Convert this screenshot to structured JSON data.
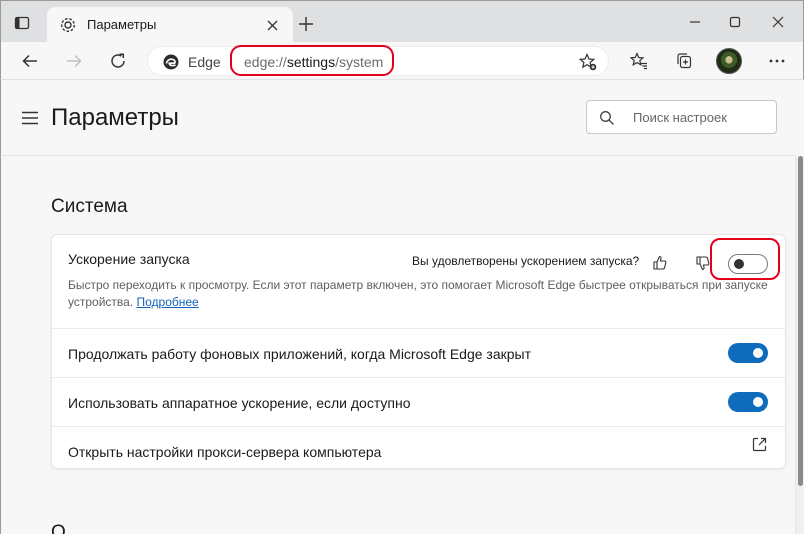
{
  "browser": {
    "tab_title": "Параметры",
    "edge_label": "Edge",
    "url_prefix": "edge://",
    "url_host": "settings",
    "url_path": "/system"
  },
  "page": {
    "title": "Параметры",
    "search_placeholder": "Поиск настроек"
  },
  "section": {
    "title": "Система",
    "next_title": "О"
  },
  "settings": {
    "startup_boost": {
      "label": "Ускорение запуска",
      "feedback_question": "Вы удовлетворены ускорением запуска?",
      "description": "Быстро переходить к просмотру. Если этот параметр включен, это помогает Microsoft Edge быстрее открываться при запуске устройства. ",
      "learn_more": "Подробнее",
      "enabled": false
    },
    "background_apps": {
      "label": "Продолжать работу фоновых приложений, когда Microsoft Edge закрыт",
      "enabled": true
    },
    "hardware_accel": {
      "label": "Использовать аппаратное ускорение, если доступно",
      "enabled": true
    },
    "proxy": {
      "label": "Открыть настройки прокси-сервера компьютера"
    }
  },
  "colors": {
    "accent": "#0f6cbd",
    "highlight": "#e3001b",
    "link": "#0f63b8"
  }
}
